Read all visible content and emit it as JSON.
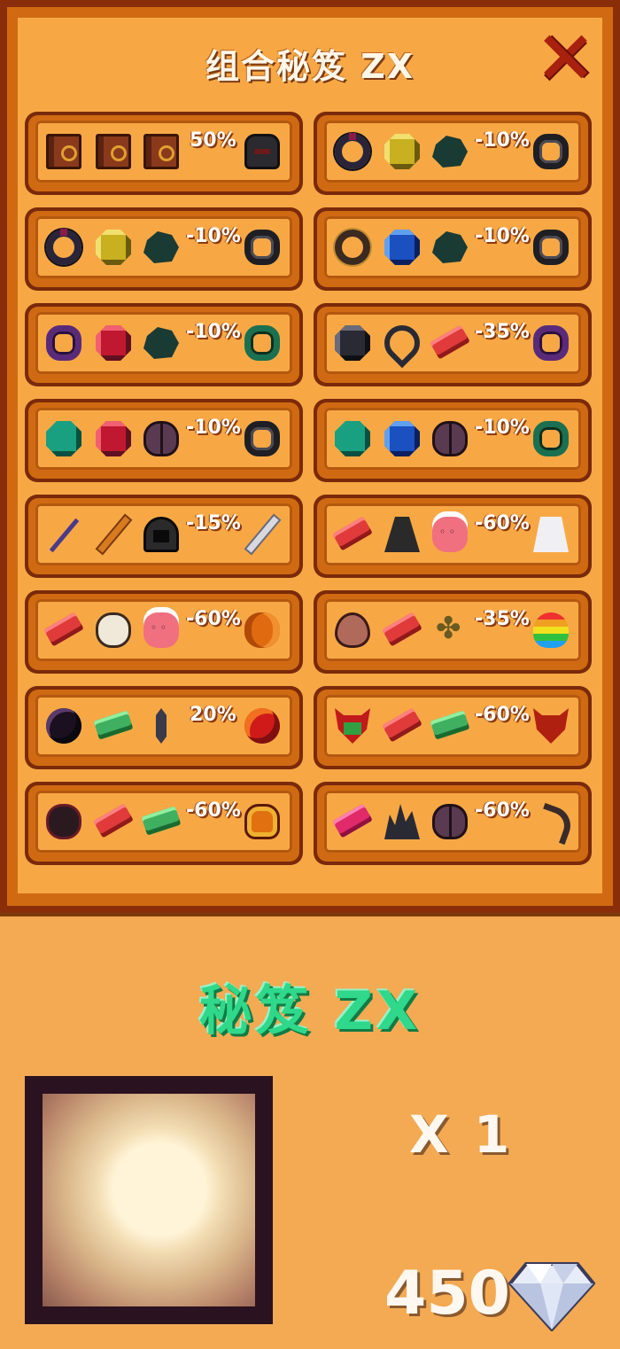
{
  "window": {
    "title": "组合秘笈 ZX",
    "close_icon": "close-x-icon"
  },
  "recipes": [
    {
      "ingredients": [
        "book-icon",
        "book-icon",
        "book-icon"
      ],
      "discount": "50%",
      "result": "dark-helmet-icon"
    },
    {
      "ingredients": [
        "dark-ring-icon",
        "yellow-gem-icon",
        "dark-ore-icon"
      ],
      "discount": "-10%",
      "result": "ring-icon"
    },
    {
      "ingredients": [
        "dark-ring-icon",
        "yellow-gem-icon",
        "dark-ore-icon"
      ],
      "discount": "-10%",
      "result": "ring-icon"
    },
    {
      "ingredients": [
        "gold-ring-icon",
        "blue-gem-icon",
        "dark-ore-icon"
      ],
      "discount": "-10%",
      "result": "ring-icon"
    },
    {
      "ingredients": [
        "purple-ring-icon",
        "red-gem-icon",
        "dark-ore-icon"
      ],
      "discount": "-10%",
      "result": "green-ring-icon"
    },
    {
      "ingredients": [
        "black-gem-icon",
        "teardrop-ring-icon",
        "red-bar-icon"
      ],
      "discount": "-35%",
      "result": "purple-ring-icon"
    },
    {
      "ingredients": [
        "teal-gem-icon",
        "red-gem-icon",
        "beetle-icon"
      ],
      "discount": "-10%",
      "result": "ring-icon"
    },
    {
      "ingredients": [
        "teal-gem-icon",
        "blue-gem-icon",
        "beetle-icon"
      ],
      "discount": "-10%",
      "result": "green-ring-icon"
    },
    {
      "ingredients": [
        "staff-icon",
        "orange-sword-icon",
        "hood-icon"
      ],
      "discount": "-15%",
      "result": "sword-icon"
    },
    {
      "ingredients": [
        "red-bar-icon",
        "cloak-icon",
        "pink-face-icon"
      ],
      "discount": "-60%",
      "result": "ghost-icon"
    },
    {
      "ingredients": [
        "red-bar-icon",
        "skull-icon",
        "pink-face-icon"
      ],
      "discount": "-60%",
      "result": "pumpkin-icon"
    },
    {
      "ingredients": [
        "egg-icon",
        "red-bar-icon",
        "clover-icon"
      ],
      "discount": "-35%",
      "result": "rainbow-icon"
    },
    {
      "ingredients": [
        "dark-orb-icon",
        "green-bar-icon",
        "shard-icon"
      ],
      "discount": "20%",
      "result": "fire-orb-icon"
    },
    {
      "ingredients": [
        "demon-mask-icon",
        "red-bar-icon",
        "green-bar-icon"
      ],
      "discount": "-60%",
      "result": "horned-mask-icon"
    },
    {
      "ingredients": [
        "oval-gem-icon",
        "red-bar-icon",
        "green-bar-icon"
      ],
      "discount": "-60%",
      "result": "fire-relic-icon"
    },
    {
      "ingredients": [
        "pink-bar-icon",
        "crystal-icon",
        "beetle-icon"
      ],
      "discount": "-60%",
      "result": "scythe-icon"
    }
  ],
  "detail": {
    "title": "秘笈 ZX",
    "item_icon": "scroll-icon",
    "quantity": "X 1",
    "price": "450",
    "currency_icon": "diamond-icon"
  }
}
